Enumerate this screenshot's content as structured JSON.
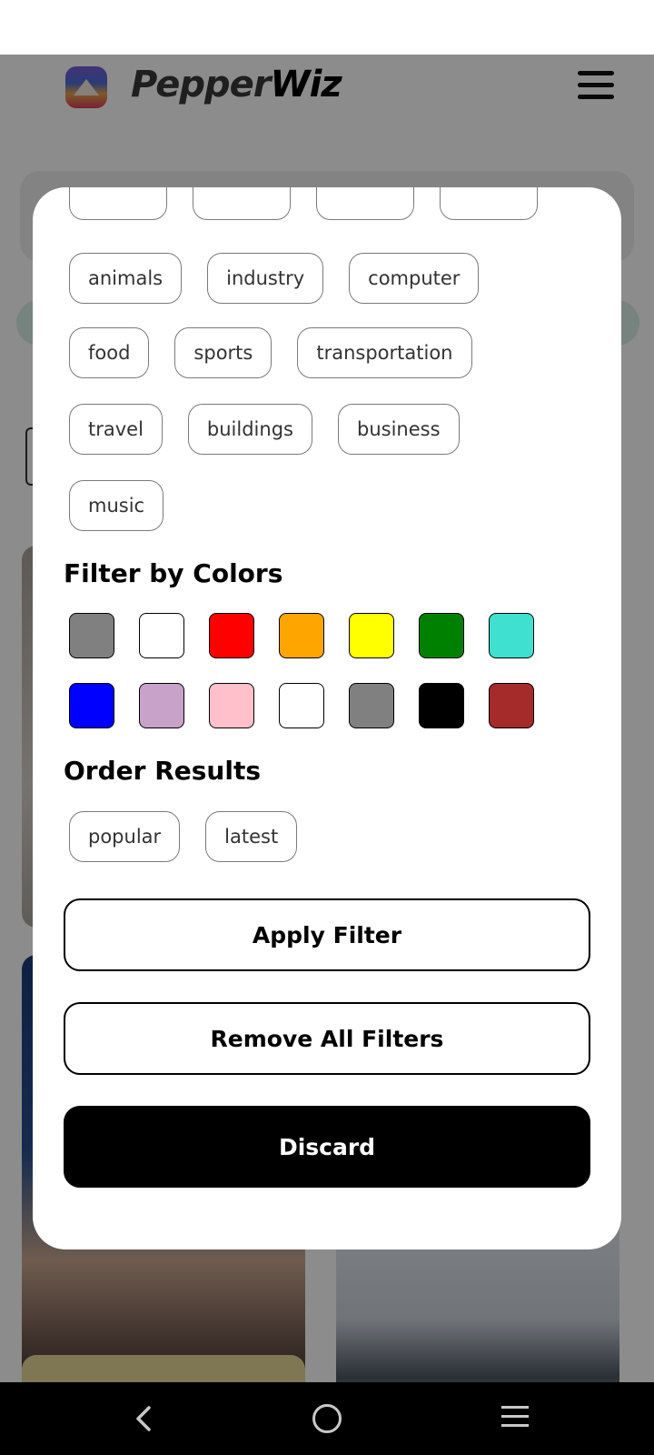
{
  "app": {
    "brand_part1": "Pepper",
    "brand_part2": "Wiz",
    "logo_icon": "mountain-logo-icon",
    "menu_icon": "hamburger-menu-icon"
  },
  "categories": [
    "animals",
    "industry",
    "computer",
    "food",
    "sports",
    "transportation",
    "travel",
    "buildings",
    "business",
    "music"
  ],
  "colors_section": {
    "title": "Filter by Colors",
    "swatches_row1": [
      "#808080",
      "#ffffff",
      "#ff0000",
      "#ffa500",
      "#ffff00",
      "#008000",
      "#40e0d0"
    ],
    "swatches_row2": [
      "#0000ff",
      "#c8a2c8",
      "#ffc0cb",
      "#ffffff",
      "#808080",
      "#000000",
      "#a52a2a"
    ]
  },
  "order_section": {
    "title": "Order Results",
    "options": [
      "popular",
      "latest"
    ]
  },
  "buttons": {
    "apply": "Apply Filter",
    "remove": "Remove All Filters",
    "discard": "Discard"
  },
  "nav": {
    "back_icon": "back-chevron-icon",
    "home_icon": "home-circle-icon",
    "recent_icon": "recent-apps-icon"
  }
}
